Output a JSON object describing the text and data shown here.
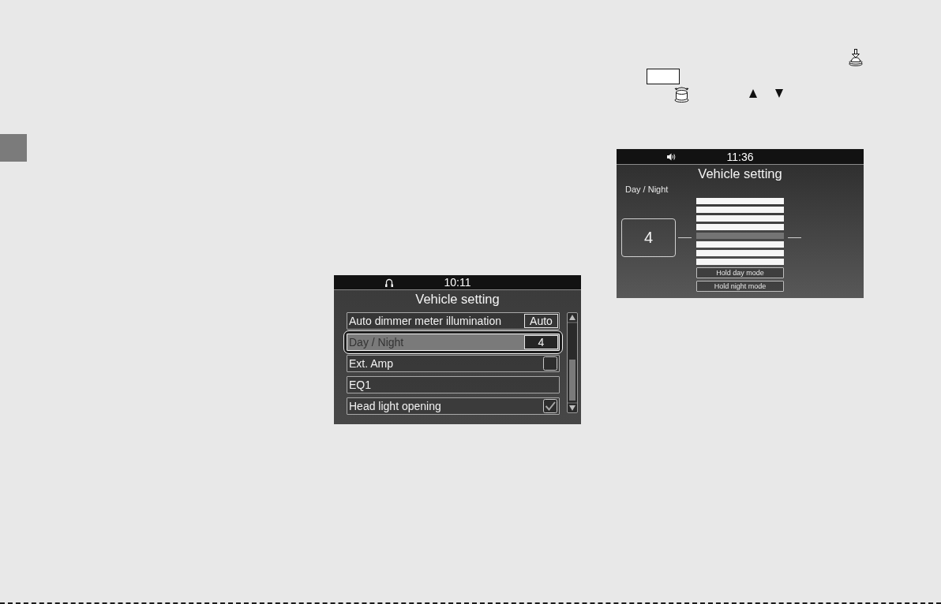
{
  "screens": [
    {
      "kind": "list",
      "status_time": "10:11",
      "title": "Vehicle setting",
      "items": [
        {
          "kind": "value",
          "label": "Auto dimmer meter illumination",
          "value": "Auto",
          "selected": false
        },
        {
          "kind": "value",
          "label": "Day / Night",
          "value": "4",
          "selected": true
        },
        {
          "kind": "checkbox",
          "label": "Ext. Amp",
          "checked": false,
          "selected": false
        },
        {
          "kind": "plain",
          "label": "EQ1",
          "selected": false
        },
        {
          "kind": "checkbox",
          "label": "Head light opening",
          "checked": true,
          "selected": false
        }
      ]
    },
    {
      "kind": "level",
      "status_time": "11:36",
      "title": "Vehicle setting",
      "label": "Day / Night",
      "value": "4",
      "levels": [
        {
          "selected": false
        },
        {
          "selected": false
        },
        {
          "selected": false
        },
        {
          "selected": false
        },
        {
          "selected": true
        },
        {
          "selected": false
        },
        {
          "selected": false
        },
        {
          "selected": false
        }
      ],
      "buttons": [
        "Hold day mode",
        "Hold night mode"
      ]
    }
  ]
}
